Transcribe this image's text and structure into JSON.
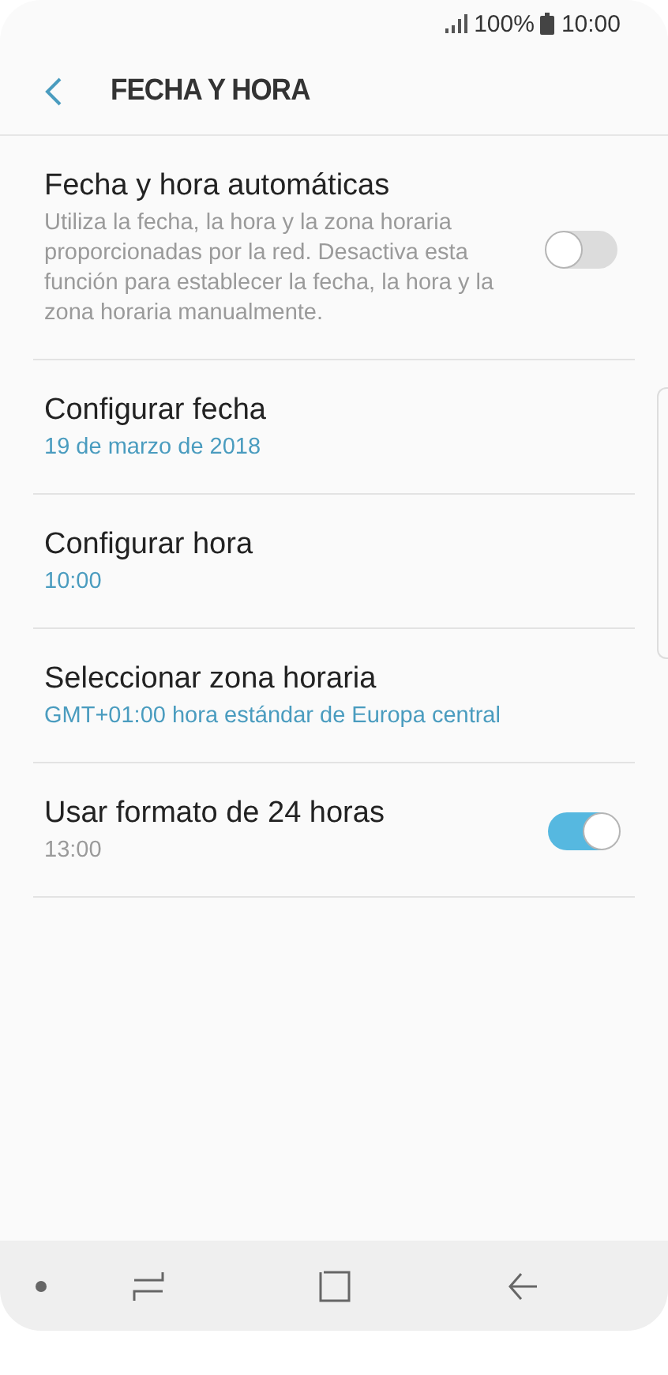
{
  "status_bar": {
    "battery": "100%",
    "time": "10:00"
  },
  "header": {
    "title": "FECHA Y HORA"
  },
  "settings": [
    {
      "kind": "toggle",
      "title": "Fecha y hora automáticas",
      "summary": "Utiliza la fecha, la hora y la zona horaria proporcionadas por la red. Desactiva esta función para establecer la fecha, la hora y la zona horaria manualmente.",
      "on": false
    },
    {
      "kind": "value",
      "title": "Configurar fecha",
      "summary": "19 de marzo de 2018"
    },
    {
      "kind": "value",
      "title": "Configurar hora",
      "summary": "10:00"
    },
    {
      "kind": "value",
      "title": "Seleccionar zona horaria",
      "summary": "GMT+01:00 hora estándar de Europa central"
    },
    {
      "kind": "toggle",
      "title": "Usar formato de 24 horas",
      "summary": "13:00",
      "on": true
    }
  ]
}
